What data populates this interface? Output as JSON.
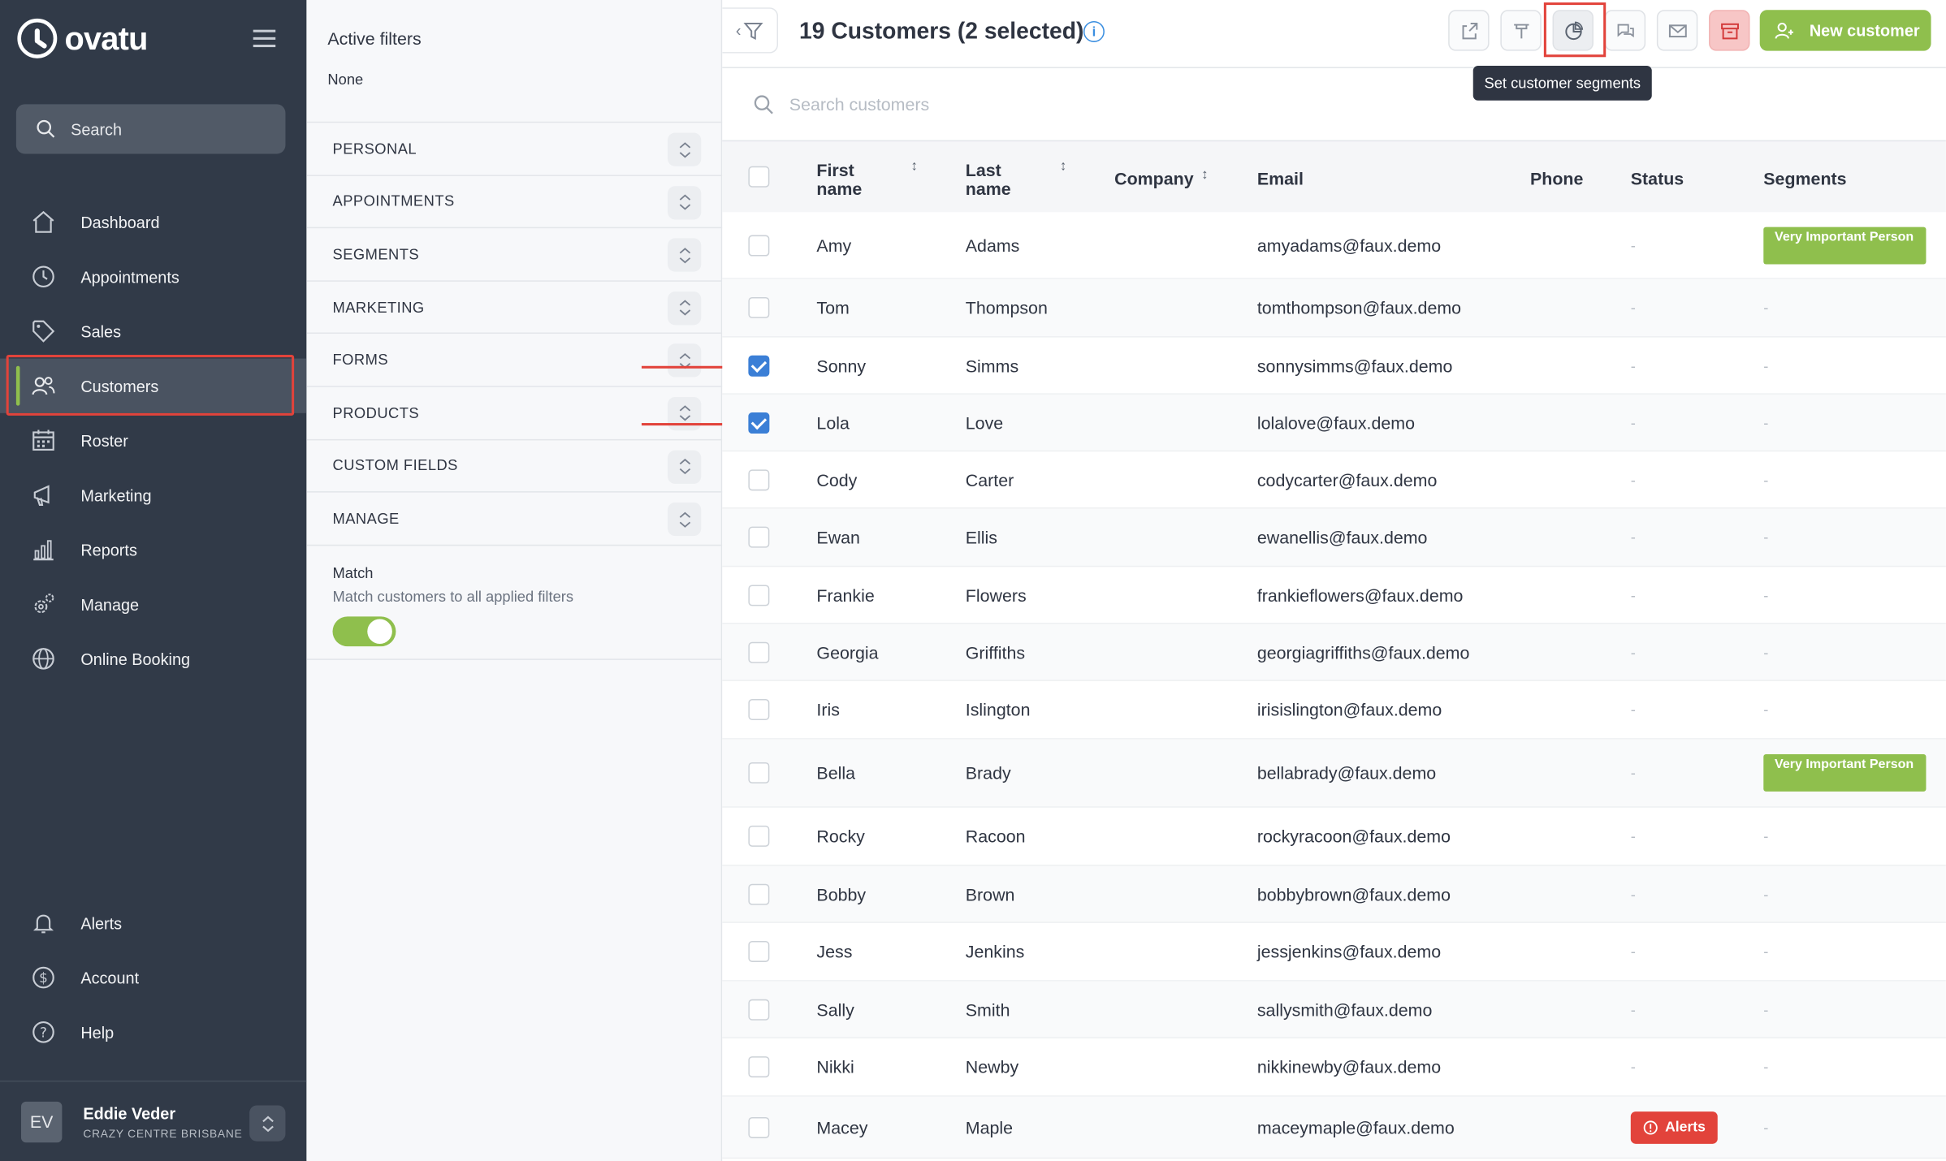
{
  "brand": {
    "name": "ovatu"
  },
  "sidebar": {
    "search_label": "Search",
    "nav": [
      {
        "label": "Dashboard",
        "icon": "home-icon"
      },
      {
        "label": "Appointments",
        "icon": "clock-icon"
      },
      {
        "label": "Sales",
        "icon": "tag-icon"
      },
      {
        "label": "Customers",
        "icon": "users-icon",
        "active": true
      },
      {
        "label": "Roster",
        "icon": "calendar-icon"
      },
      {
        "label": "Marketing",
        "icon": "megaphone-icon"
      },
      {
        "label": "Reports",
        "icon": "bar-chart-icon"
      },
      {
        "label": "Manage",
        "icon": "gears-icon"
      },
      {
        "label": "Online Booking",
        "icon": "globe-icon"
      }
    ],
    "bottom_nav": [
      {
        "label": "Alerts",
        "icon": "bell-icon"
      },
      {
        "label": "Account",
        "icon": "dollar-circle-icon"
      },
      {
        "label": "Help",
        "icon": "question-icon"
      }
    ],
    "user": {
      "initials": "EV",
      "name": "Eddie Veder",
      "org": "CRAZY CENTRE BRISBANE"
    }
  },
  "filters": {
    "active_title": "Active filters",
    "active_value": "None",
    "sections": [
      "PERSONAL",
      "APPOINTMENTS",
      "SEGMENTS",
      "MARKETING",
      "FORMS",
      "PRODUCTS",
      "CUSTOM FIELDS",
      "MANAGE"
    ],
    "match_title": "Match",
    "match_desc": "Match customers to all applied filters",
    "match_enabled": true
  },
  "header": {
    "title": "19 Customers (2 selected)",
    "tooltip": "Set customer segments",
    "new_button": "New customer",
    "accent": "#8fbf4d",
    "danger": "#e2433b"
  },
  "search": {
    "placeholder": "Search customers"
  },
  "table": {
    "columns": [
      "First name",
      "Last name",
      "Company",
      "Email",
      "Phone",
      "Status",
      "Segments"
    ],
    "empty": "-",
    "rows": [
      {
        "first": "Amy",
        "last": "Adams",
        "email": "amyadams@faux.demo",
        "selected": false,
        "segment": "Very Important Person"
      },
      {
        "first": "Tom",
        "last": "Thompson",
        "email": "tomthompson@faux.demo",
        "selected": false
      },
      {
        "first": "Sonny",
        "last": "Simms",
        "email": "sonnysimms@faux.demo",
        "selected": true
      },
      {
        "first": "Lola",
        "last": "Love",
        "email": "lolalove@faux.demo",
        "selected": true
      },
      {
        "first": "Cody",
        "last": "Carter",
        "email": "codycarter@faux.demo",
        "selected": false
      },
      {
        "first": "Ewan",
        "last": "Ellis",
        "email": "ewanellis@faux.demo",
        "selected": false
      },
      {
        "first": "Frankie",
        "last": "Flowers",
        "email": "frankieflowers@faux.demo",
        "selected": false
      },
      {
        "first": "Georgia",
        "last": "Griffiths",
        "email": "georgiagriffiths@faux.demo",
        "selected": false
      },
      {
        "first": "Iris",
        "last": "Islington",
        "email": "irisislington@faux.demo",
        "selected": false
      },
      {
        "first": "Bella",
        "last": "Brady",
        "email": "bellabrady@faux.demo",
        "selected": false,
        "segment": "Very Important Person"
      },
      {
        "first": "Rocky",
        "last": "Racoon",
        "email": "rockyracoon@faux.demo",
        "selected": false
      },
      {
        "first": "Bobby",
        "last": "Brown",
        "email": "bobbybrown@faux.demo",
        "selected": false
      },
      {
        "first": "Jess",
        "last": "Jenkins",
        "email": "jessjenkins@faux.demo",
        "selected": false
      },
      {
        "first": "Sally",
        "last": "Smith",
        "email": "sallysmith@faux.demo",
        "selected": false
      },
      {
        "first": "Nikki",
        "last": "Newby",
        "email": "nikkinewby@faux.demo",
        "selected": false
      },
      {
        "first": "Macey",
        "last": "Maple",
        "email": "maceymaple@faux.demo",
        "selected": false,
        "status": "Alerts"
      }
    ]
  }
}
